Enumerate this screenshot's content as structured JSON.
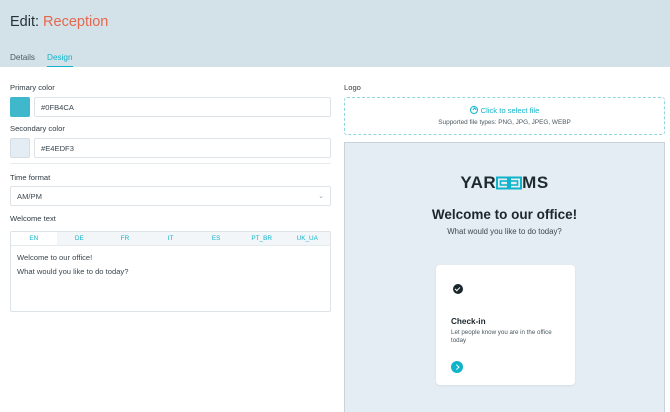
{
  "header": {
    "title_prefix": "Edit:",
    "title_name": "Reception",
    "tabs": [
      {
        "label": "Details",
        "active": false
      },
      {
        "label": "Design",
        "active": true
      }
    ]
  },
  "form": {
    "primary_color": {
      "label": "Primary color",
      "value": "#0FB4CA",
      "swatch": "#3fb8cc"
    },
    "secondary_color": {
      "label": "Secondary color",
      "value": "#E4EDF3",
      "swatch": "#e4edf3"
    },
    "time_format": {
      "label": "Time format",
      "value": "AM/PM"
    },
    "welcome_text": {
      "label": "Welcome text",
      "languages": [
        "EN",
        "DE",
        "FR",
        "IT",
        "ES",
        "PT_BR",
        "UK_UA"
      ],
      "active_language": "EN",
      "line1": "Welcome to our office!",
      "line2": "What would you like to do today?"
    }
  },
  "logo_upload": {
    "label": "Logo",
    "action": "Click to select file",
    "supported": "Supported file types: PNG, JPG, JPEG, WEBP"
  },
  "preview": {
    "logo_left": "YAR",
    "logo_right": "MS",
    "title": "Welcome to our office!",
    "subtitle": "What would you like to do today?",
    "card": {
      "title": "Check-in",
      "description": "Let people know you are in the office today"
    }
  }
}
